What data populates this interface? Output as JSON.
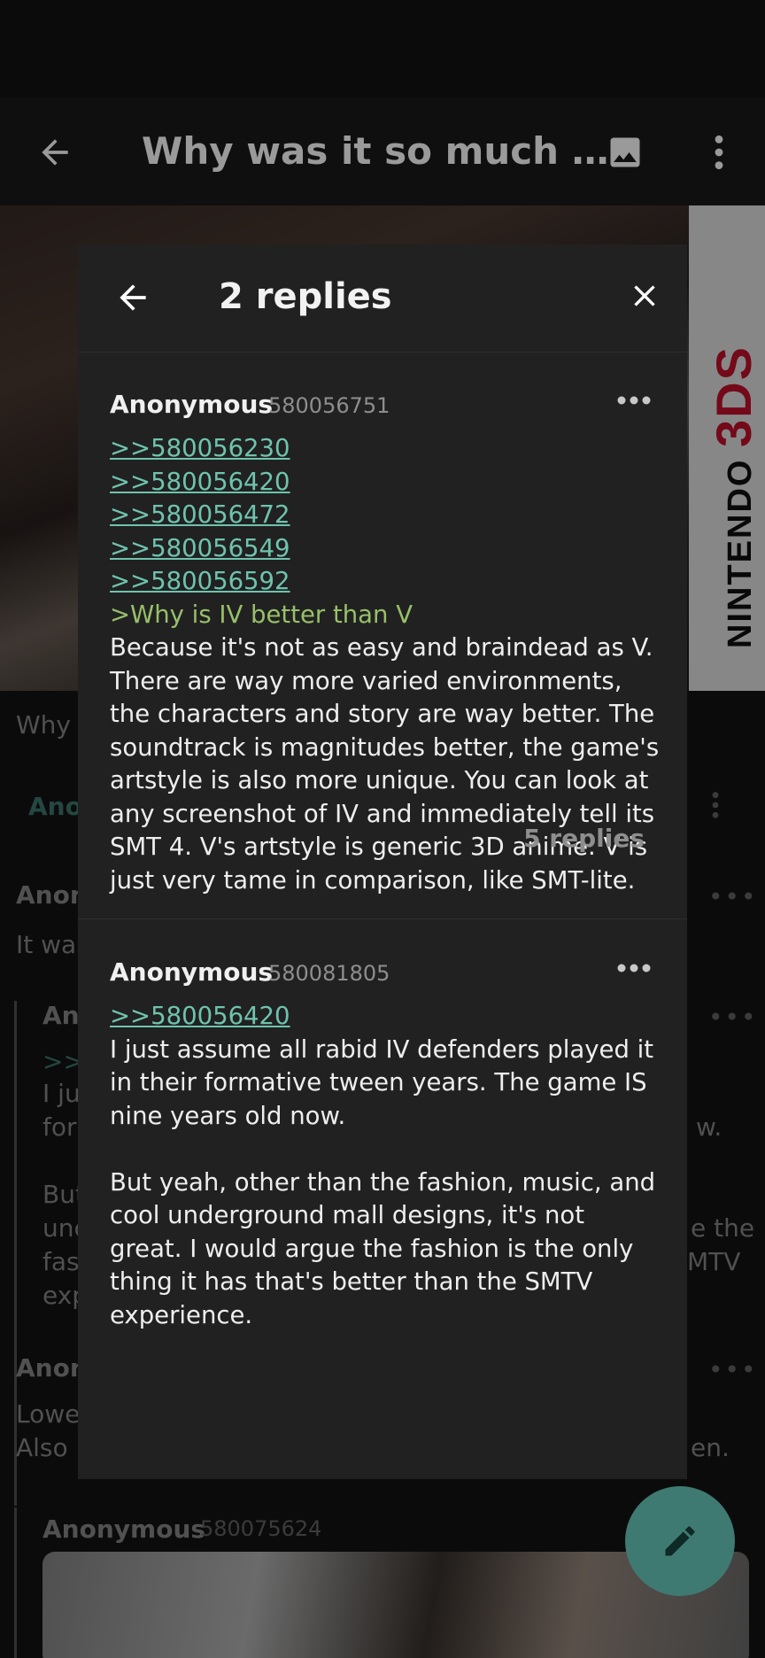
{
  "app_bar": {
    "title": "Why was it so much …"
  },
  "background_thread": {
    "op_snippet": "Why w",
    "tab_label": "Ano",
    "posts": [
      {
        "name": "Anon",
        "text": "It was"
      },
      {
        "name": "Ano",
        "quote": ">>5",
        "lines": [
          "I ju",
          "for",
          "",
          "But",
          "unc",
          "fas",
          "exp"
        ],
        "right_fragments": [
          "w.",
          "e the",
          "MTV"
        ]
      },
      {
        "name": "Anon",
        "lines": [
          "Lowe",
          "Also"
        ],
        "right_fragments": [
          "en."
        ]
      },
      {
        "name": "Anonymous",
        "number": "580075624"
      }
    ],
    "cover_brand": "NINTENDO",
    "cover_brand_3ds": "3DS"
  },
  "dialog": {
    "title": "2 replies",
    "posts": [
      {
        "name": "Anonymous",
        "number": "580056751",
        "quotes": [
          ">>580056230",
          ">>580056420",
          ">>580056472",
          ">>580056549",
          ">>580056592"
        ],
        "greentext": ">Why is IV better than V",
        "lines": [
          "Because it's not as easy and braindead as V.",
          "There are way more varied environments,",
          "the characters and story are way better. The",
          "soundtrack is magnitudes better, the game's",
          "artstyle is also more unique. You can look at",
          "any screenshot of IV and immediately tell its",
          "SMT 4. V's artstyle is generic 3D anime. V is",
          "just very tame in comparison, like SMT-lite."
        ],
        "replies_label": "5 replies"
      },
      {
        "name": "Anonymous",
        "number": "580081805",
        "quotes": [
          ">>580056420"
        ],
        "lines_a": [
          "I just assume all rabid IV defenders played it",
          "in their formative tween years. The game IS",
          "nine years old now."
        ],
        "lines_b": [
          "But yeah, other than the fashion, music, and",
          "cool underground mall designs, it's not",
          "great. I would argue the fashion is the only",
          "thing it has that's better than the SMTV",
          "experience."
        ]
      }
    ]
  },
  "colors": {
    "quote_link": "#6fc3ae",
    "greentext": "#98bf6a",
    "fab": "#3f7a72",
    "dialog_bg": "#212121"
  },
  "icons": [
    "back-arrow-icon",
    "image-icon",
    "more-vert-icon",
    "close-icon",
    "more-horiz-icon",
    "edit-pencil-icon"
  ]
}
